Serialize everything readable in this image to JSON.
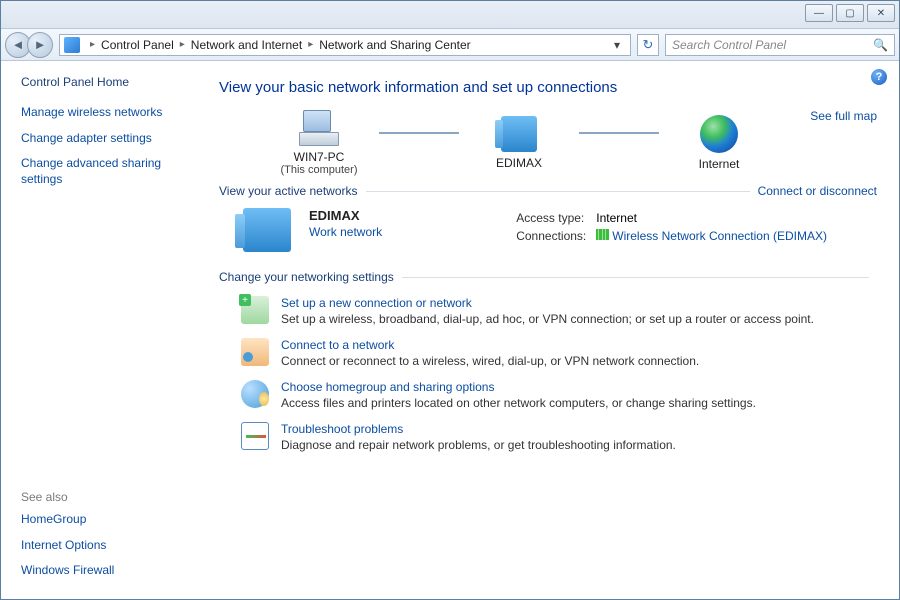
{
  "window_controls": {
    "minimize": "—",
    "maximize": "▢",
    "close": "✕"
  },
  "toolbar": {
    "breadcrumb": [
      "Control Panel",
      "Network and Internet",
      "Network and Sharing Center"
    ],
    "search_placeholder": "Search Control Panel"
  },
  "sidebar": {
    "home": "Control Panel Home",
    "links": [
      "Manage wireless networks",
      "Change adapter settings",
      "Change advanced sharing settings"
    ],
    "see_also_header": "See also",
    "see_also": [
      "HomeGroup",
      "Internet Options",
      "Windows Firewall"
    ]
  },
  "content": {
    "heading": "View your basic network information and set up connections",
    "map": {
      "node1": "WIN7-PC",
      "node1_sub": "(This computer)",
      "node2": "EDIMAX",
      "node3": "Internet",
      "full_map": "See full map"
    },
    "active_section": {
      "label": "View your active networks",
      "action": "Connect or disconnect",
      "network_name": "EDIMAX",
      "network_type": "Work network",
      "access_label": "Access type:",
      "access_value": "Internet",
      "connections_label": "Connections:",
      "connection_link": "Wireless Network Connection (EDIMAX)"
    },
    "change_section_label": "Change your networking settings",
    "tasks": [
      {
        "title": "Set up a new connection or network",
        "desc": "Set up a wireless, broadband, dial-up, ad hoc, or VPN connection; or set up a router or access point."
      },
      {
        "title": "Connect to a network",
        "desc": "Connect or reconnect to a wireless, wired, dial-up, or VPN network connection."
      },
      {
        "title": "Choose homegroup and sharing options",
        "desc": "Access files and printers located on other network computers, or change sharing settings."
      },
      {
        "title": "Troubleshoot problems",
        "desc": "Diagnose and repair network problems, or get troubleshooting information."
      }
    ]
  }
}
